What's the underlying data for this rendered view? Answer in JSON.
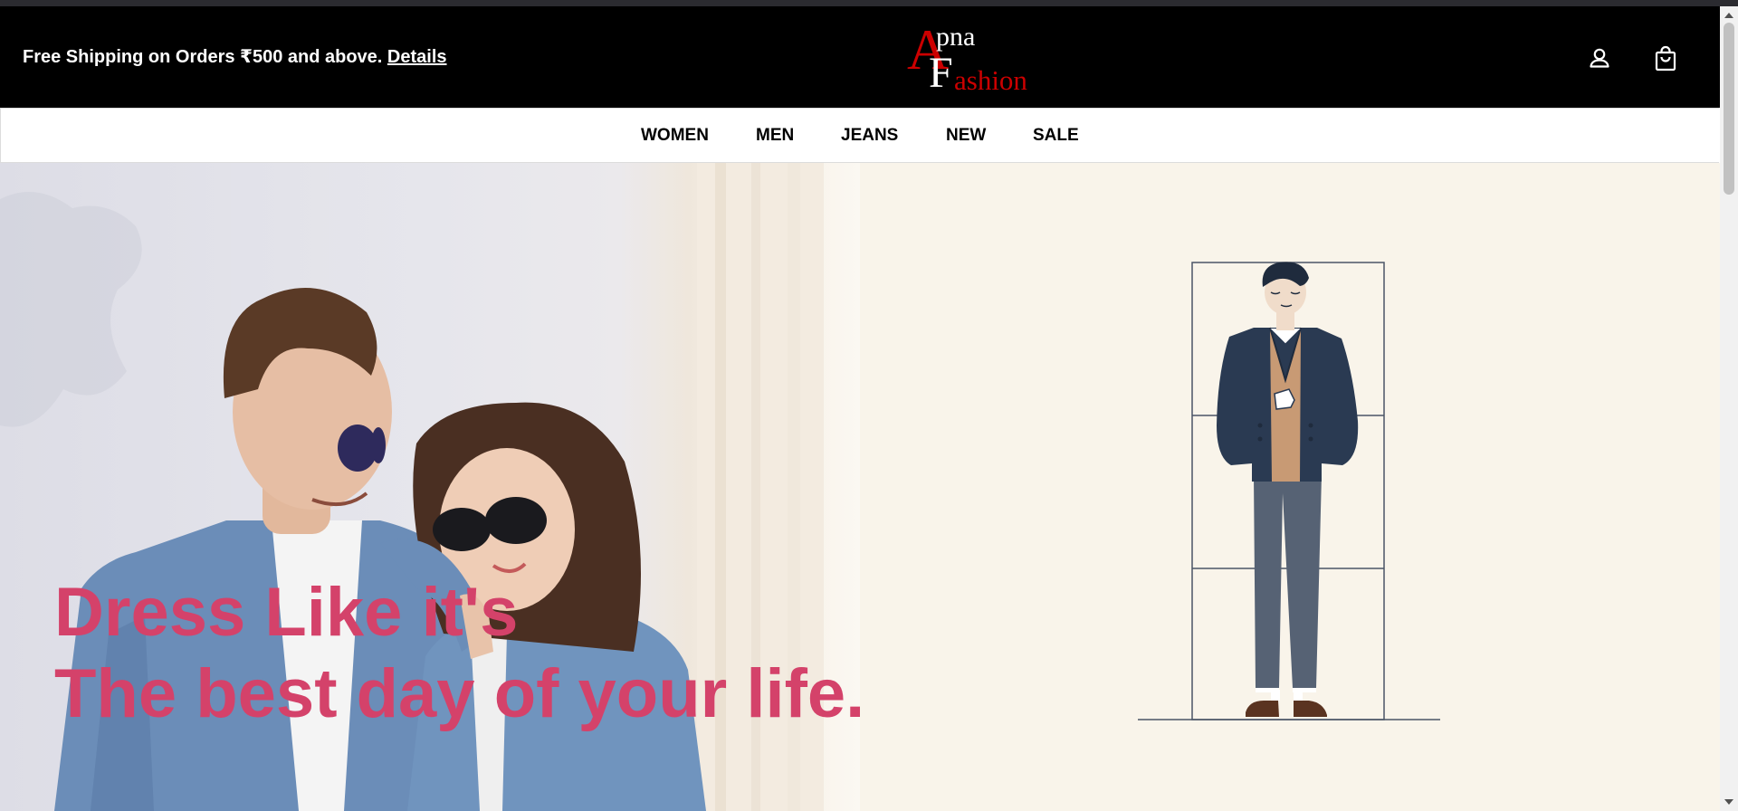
{
  "announcement": {
    "text": "Free Shipping on Orders ₹500 and above.",
    "link_label": "Details"
  },
  "logo": {
    "big_a": "A",
    "big_f": "F",
    "small_pna": "pna",
    "small_ashion": "ashion"
  },
  "header_icons": {
    "account": "account-icon",
    "bag": "shopping-bag-icon"
  },
  "nav": {
    "items": [
      {
        "label": "WOMEN"
      },
      {
        "label": "MEN"
      },
      {
        "label": "JEANS"
      },
      {
        "label": "NEW"
      },
      {
        "label": "SALE"
      }
    ]
  },
  "hero": {
    "headline_line1": "Dress Like it's",
    "headline_line2": "The best day of your life.",
    "illustration": "man-in-jacket-size-guide-illustration"
  },
  "colors": {
    "header_bg": "#000000",
    "logo_red": "#cc0000",
    "headline_pink": "#d4426a",
    "hero_right_bg": "#f9f4ea",
    "jacket_navy": "#2a3a52",
    "trousers_gray": "#566274"
  }
}
